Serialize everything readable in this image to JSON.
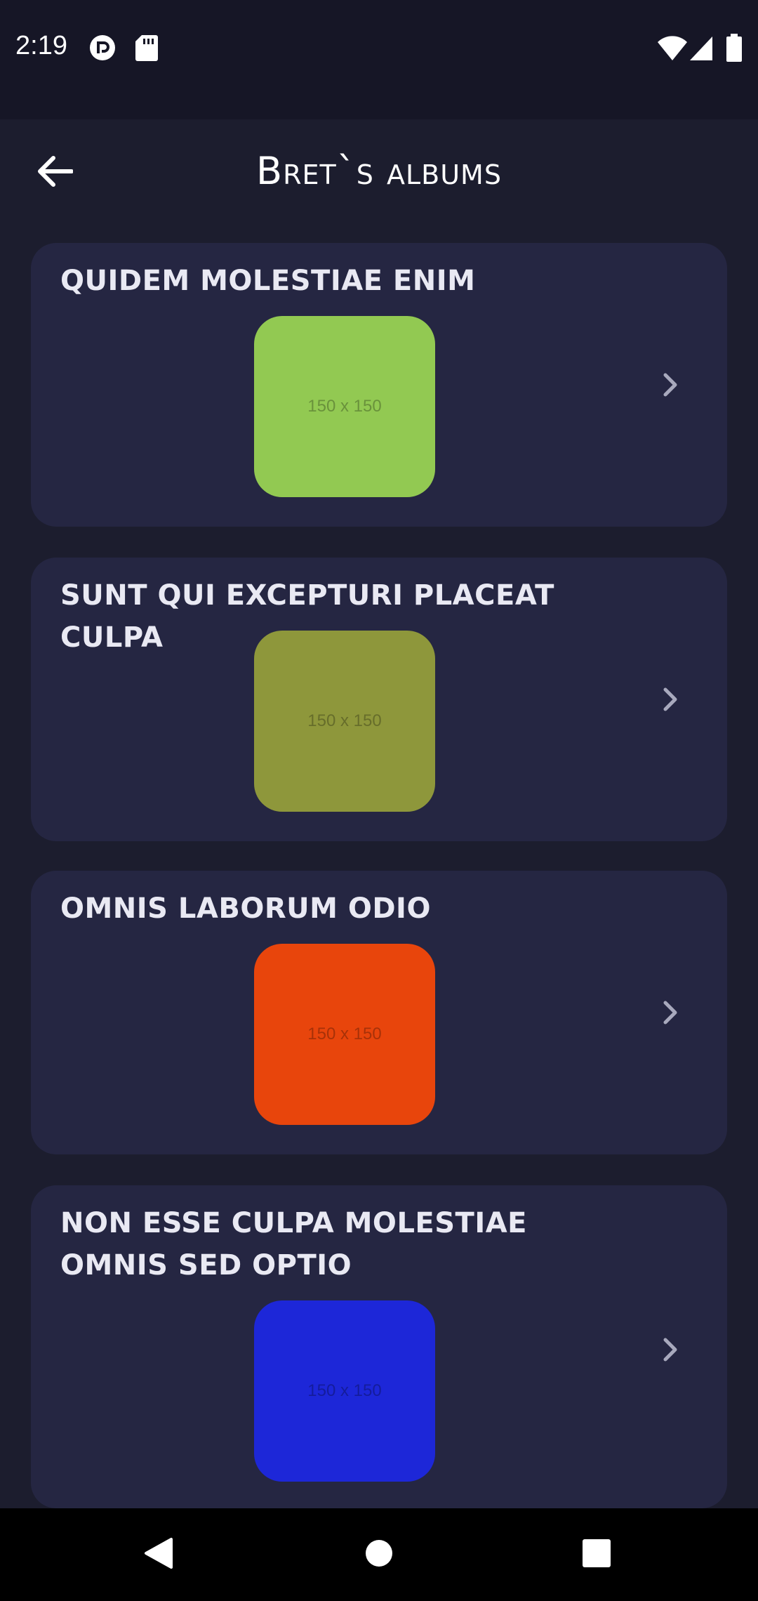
{
  "status_bar": {
    "time": "2:19",
    "icons_left": [
      "pocket-casts-icon",
      "sd-card-icon"
    ],
    "icons_right": [
      "wifi-icon",
      "signal-icon",
      "battery-icon"
    ]
  },
  "app_bar": {
    "title": "Bret`s albums",
    "back_icon": "arrow-back-icon"
  },
  "albums": [
    {
      "title": "QUIDEM MOLESTIAE ENIM",
      "thumb_label": "150 x 150",
      "thumb_color": "#92c952"
    },
    {
      "title": "SUNT QUI EXCEPTURI PLACEAT CULPA",
      "thumb_label": "150 x 150",
      "thumb_color": "#8e973b"
    },
    {
      "title": "OMNIS LABORUM ODIO",
      "thumb_label": "150 x 150",
      "thumb_color": "#e8450c"
    },
    {
      "title": "NON ESSE CULPA MOLESTIAE OMNIS SED OPTIO",
      "thumb_label": "150 x 150",
      "thumb_color": "#1d27d8"
    }
  ],
  "colors": {
    "background": "#1c1d2e",
    "card": "#252642",
    "status_bar": "#161626"
  },
  "nav_bar": {
    "buttons": [
      "back-triangle-icon",
      "home-circle-icon",
      "recents-square-icon"
    ]
  }
}
